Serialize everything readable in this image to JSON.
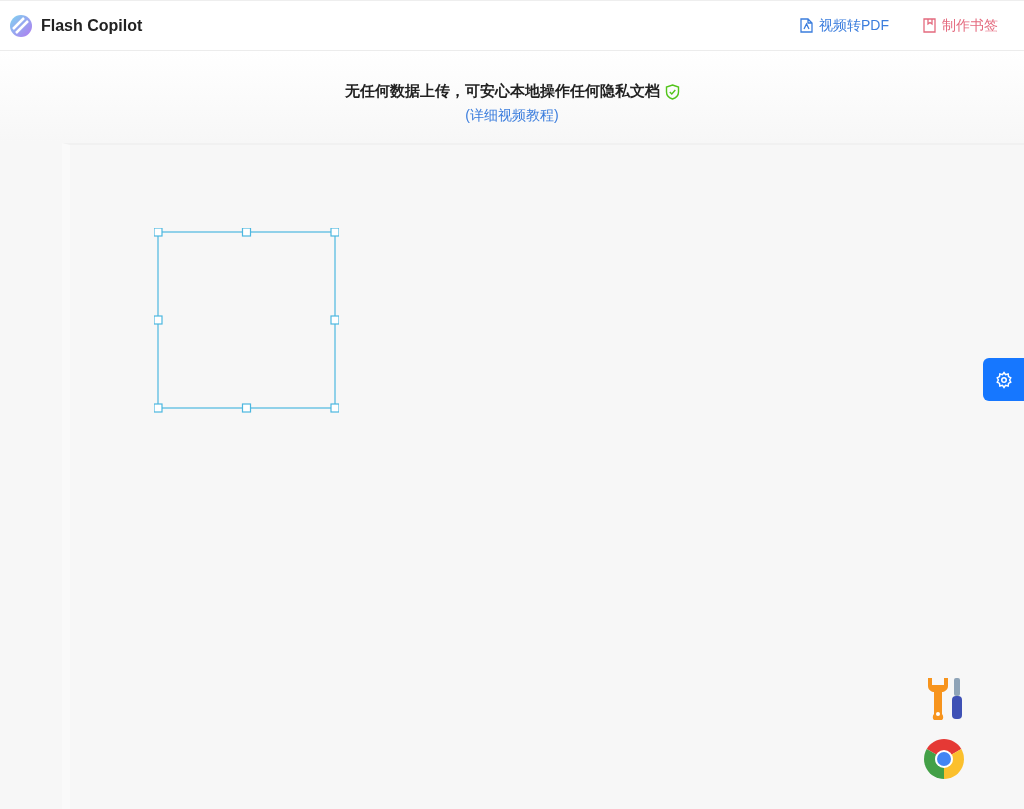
{
  "header": {
    "brand": "Flash Copilot",
    "links": [
      {
        "kind": "pdf",
        "label": "视频转PDF"
      },
      {
        "kind": "bookmark",
        "label": "制作书签"
      }
    ]
  },
  "notice": {
    "text": "无任何数据上传，可安心本地操作任何隐私文档",
    "link": "(详细视频教程)"
  }
}
